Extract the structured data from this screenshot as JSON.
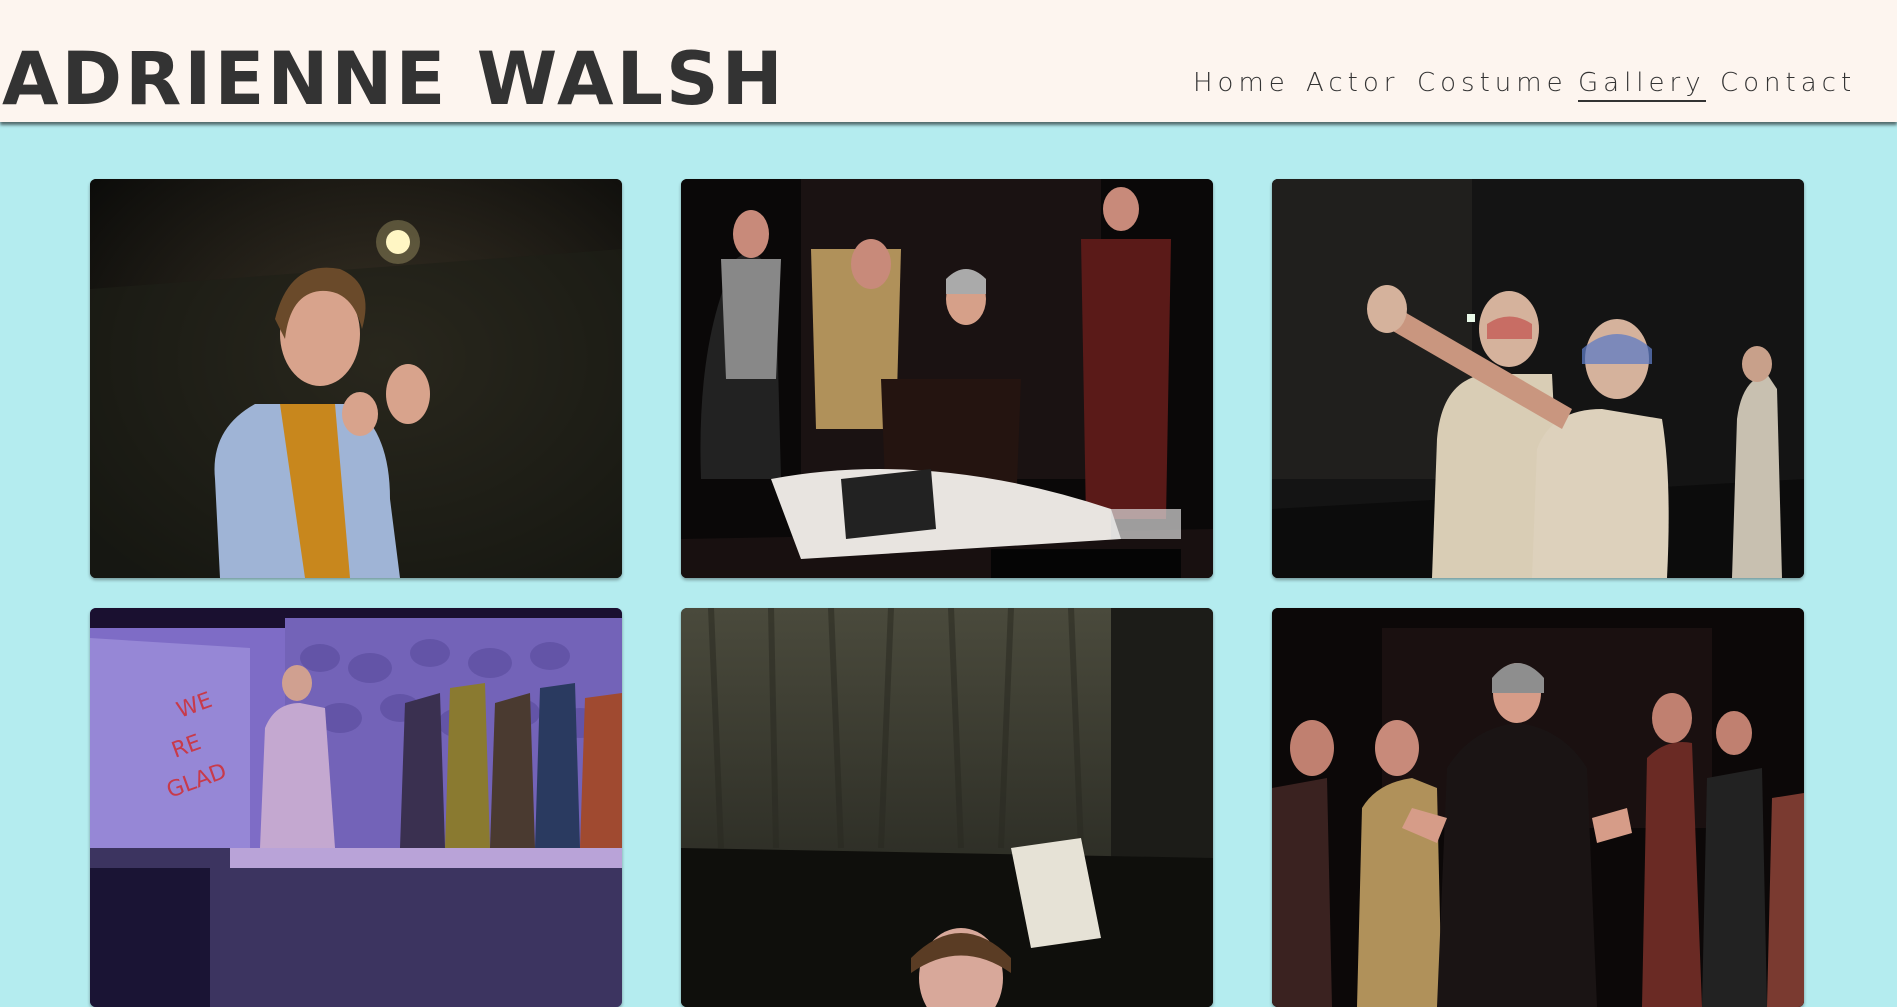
{
  "site": {
    "title": "ADRIENNE WALSH"
  },
  "nav": {
    "items": [
      {
        "label": "Home"
      },
      {
        "label": "Actor"
      },
      {
        "label": "Costume"
      },
      {
        "label": "Gallery",
        "active": true
      },
      {
        "label": "Contact"
      }
    ]
  },
  "colors": {
    "page_background": "#b4ecef",
    "header_background": "#fdf5ef",
    "text": "#333333"
  },
  "gallery": {
    "photos": [
      {
        "description": "Performer in blue dress and yellow scarf gesturing on dark stage"
      },
      {
        "description": "Ensemble cast in red light with figure lying across stage front"
      },
      {
        "description": "Two performers with painted faces, one pointing outward"
      },
      {
        "description": "Woman in dress on purple-lit stage set with stone wall and ensemble"
      },
      {
        "description": "Empty stage with grey draped curtains, performer at bottom"
      },
      {
        "description": "Ensemble in red light around central figure in grey hood"
      }
    ]
  }
}
